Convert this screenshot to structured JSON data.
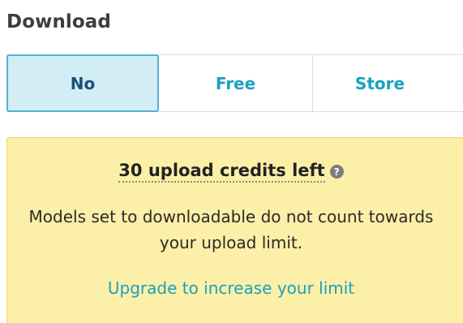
{
  "download": {
    "title": "Download",
    "options": [
      {
        "label": "No",
        "selected": true
      },
      {
        "label": "Free",
        "selected": false
      },
      {
        "label": "Store",
        "selected": false
      }
    ]
  },
  "notice": {
    "credits": "30 upload credits left",
    "help_icon": "question-circle-icon",
    "description": "Models set to downloadable do not count towards your upload limit.",
    "upgrade_link": "Upgrade to increase your limit"
  },
  "colors": {
    "accent": "#1aa1bf",
    "selected_bg": "#d3edf5",
    "selected_border": "#56b0d2",
    "notice_bg": "#fcefa7"
  }
}
